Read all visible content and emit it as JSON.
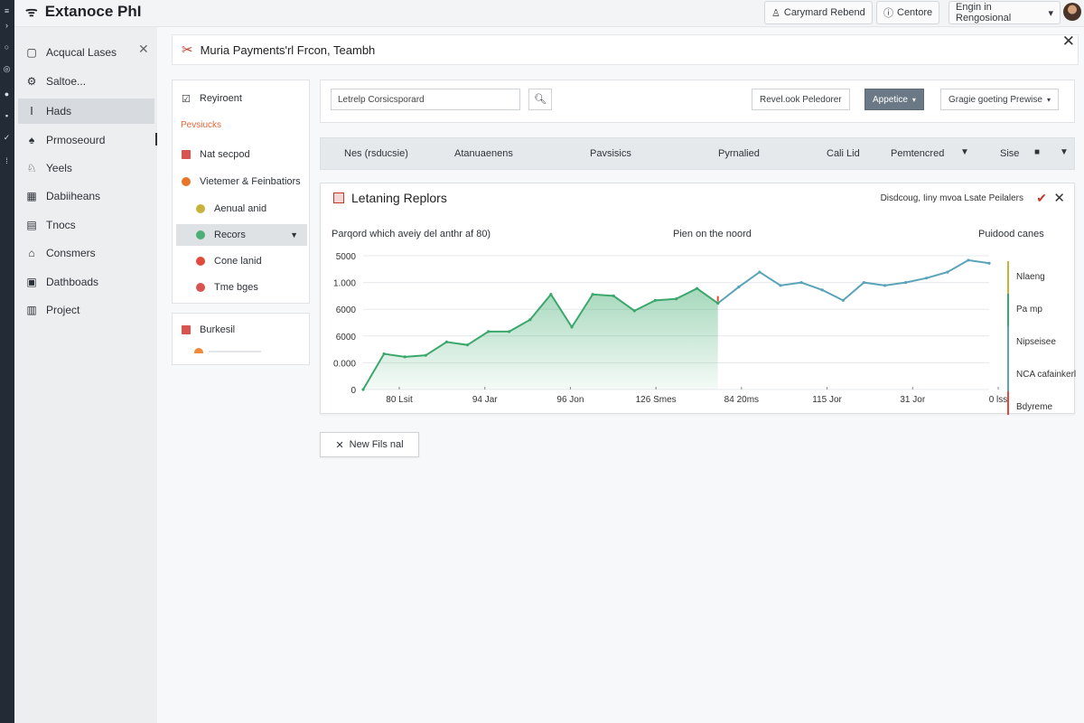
{
  "app": {
    "title": "Extanoce PhI"
  },
  "topbar": {
    "btn1": "Carymard Rebend",
    "btn2": "Centore",
    "select": "Engin in Rengosional"
  },
  "sidebar": {
    "items": [
      {
        "label": "Acqucal Lases",
        "icon": "folder-icon"
      },
      {
        "label": "Saltoe...",
        "icon": "gear-icon"
      },
      {
        "label": "Hads",
        "icon": "bookmark-icon"
      },
      {
        "label": "Prmoseourd",
        "icon": "spade-icon"
      },
      {
        "label": "Yeels",
        "icon": "person-icon"
      },
      {
        "label": "Dabiiheans",
        "icon": "grid-icon"
      },
      {
        "label": "Tnocs",
        "icon": "grid-icon"
      },
      {
        "label": "Consmers",
        "icon": "lock-icon"
      },
      {
        "label": "Dathboads",
        "icon": "grid-icon"
      },
      {
        "label": "Project",
        "icon": "folder-icon"
      }
    ]
  },
  "dialog": {
    "title": "Muria Payments'rl Frcon, Teambh"
  },
  "leftpanel": {
    "header": "Reyiroent",
    "section": "Pevsiucks",
    "items": [
      {
        "label": "Nat secpod",
        "color": "#d9534f"
      },
      {
        "label": "Vietemer & Feinbatiors",
        "color": "#e8752a"
      },
      {
        "label": "Aenual anid",
        "color": "#c9b23a"
      },
      {
        "label": "Recors",
        "color": "#4caf78"
      },
      {
        "label": "Cone lanid",
        "color": "#e04a3c"
      },
      {
        "label": "Tme bges",
        "color": "#d9534f"
      }
    ],
    "footer": "Burkesil"
  },
  "search": {
    "value": "Letrelp Corsicsporard",
    "btn_report": "Revel.ook Peledorer",
    "btn_primary": "Appetice",
    "btn_group": "Gragie goeting Prewise"
  },
  "columns": {
    "c1": "Nes (rsducsie)",
    "c2": "Atanuaenens",
    "c3": "Pavsisics",
    "c4": "Pyrnalied",
    "c5": "Cali Lid",
    "c6": "Pemtencred",
    "c7": "Sise"
  },
  "chart_panel": {
    "title": "Letaning Replors",
    "right_text": "Disdcoug, Iiny mvoa Lsate Peilalers",
    "sub_left": "Parqord which aveiy del anthr af 80)",
    "sub_mid": "Pien on the noord",
    "sub_right": "Puidood canes",
    "legend": [
      "Nlaeng",
      "Pa mp",
      "Nipseisee",
      "NCA cafainkerl",
      "Bdyreme"
    ]
  },
  "chart_data": {
    "type": "line",
    "x": [
      "80 Lsit",
      "94 Jar",
      "96 Jon",
      "126 Smes",
      "84 20ms",
      "115 Jor",
      "31 Jor",
      "0 lss"
    ],
    "y_ticks": [
      "5000",
      "1.000",
      "6000",
      "6000",
      "0.000",
      "0"
    ],
    "series": [
      {
        "values": [
          0,
          1.2,
          1.1,
          1.15,
          1.6,
          1.5,
          1.95,
          1.95,
          2.35,
          3.2,
          2.1,
          3.2,
          3.15,
          2.65,
          3.0,
          3.05,
          3.4,
          2.9,
          3.45,
          3.95,
          3.5,
          3.6,
          3.35,
          3.0,
          3.6,
          3.5,
          3.6,
          3.75,
          3.95,
          4.35,
          4.25
        ]
      },
      {
        "values": [
          0,
          1.2,
          1.1,
          1.15,
          1.6,
          1.5,
          1.95,
          1.95,
          2.35,
          3.2,
          2.1,
          3.2,
          3.15,
          2.65,
          3.0,
          3.05,
          3.4,
          2.9,
          3.45,
          3.95,
          3.5,
          3.6,
          3.35,
          3.0,
          3.6,
          3.5,
          3.6,
          3.75,
          3.95,
          4.35,
          4.25
        ]
      }
    ]
  },
  "new_button": {
    "label": "New Fils nal"
  },
  "colors": {
    "accent": "#3aa86a",
    "primary_btn": "#6a7985"
  }
}
